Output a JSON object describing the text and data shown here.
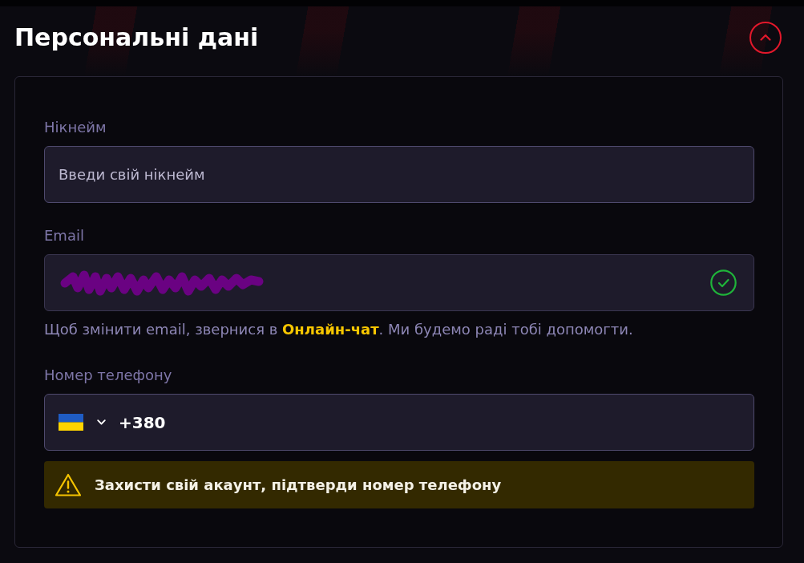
{
  "section": {
    "title": "Персональні дані",
    "expanded": true
  },
  "fields": [
    {
      "kind": "text",
      "label": "Нікнейм",
      "placeholder": "Введи свій нікнейм"
    },
    {
      "kind": "email",
      "label": "Email",
      "redacted": true,
      "verified": true,
      "hint": {
        "before": "Щоб змінити email, звернися в ",
        "link": "Онлайн-чат",
        "after": ". Ми будемо раді тобі допомогти."
      }
    },
    {
      "kind": "phone",
      "label": "Номер телефону",
      "value": "+380"
    }
  ],
  "warning": {
    "text": "Захисти свій акаунт, підтверди номер телефону"
  }
}
